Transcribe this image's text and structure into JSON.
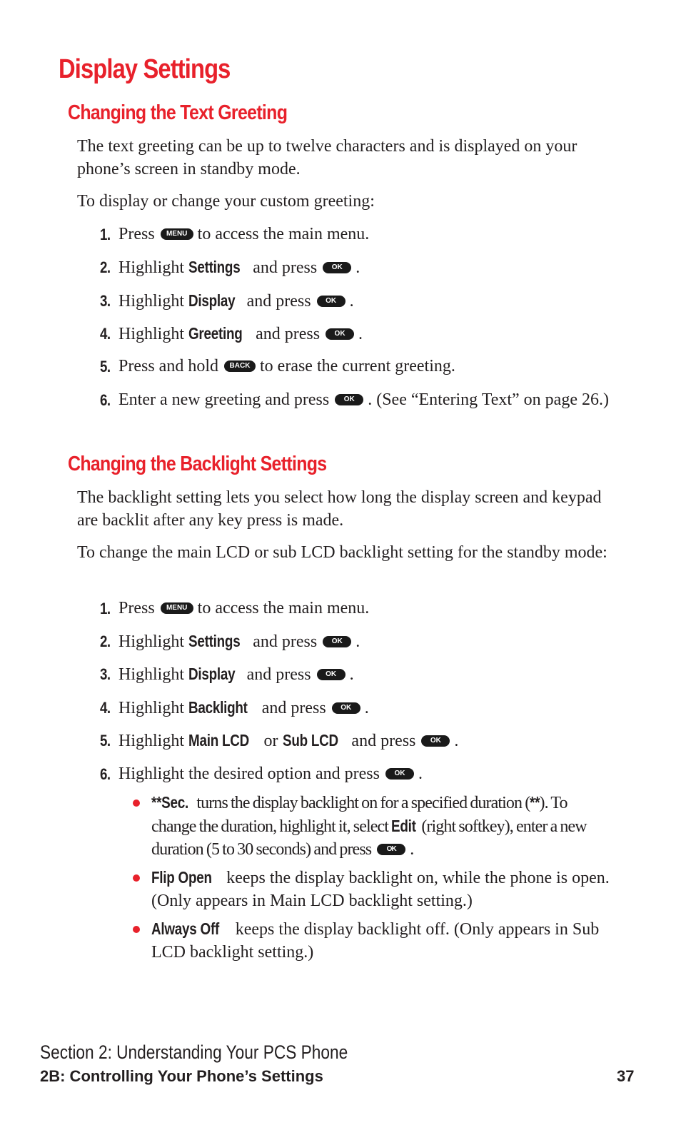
{
  "page_title": "Display Settings",
  "accent_color": "#e8212b",
  "sections": [
    {
      "title": "Changing the Text Greeting",
      "paragraphs": [
        "The text greeting can be up to twelve characters and is displayed on your phone’s screen in standby mode.",
        "To display or change your custom greeting:"
      ],
      "steps": [
        {
          "num": "1.",
          "pre": "Press",
          "key": "MENU",
          "post": "to access the main menu."
        },
        {
          "num": "2.",
          "pre": "Highlight",
          "kw": "Settings",
          "mid": "and press",
          "key": "OK",
          "post": "."
        },
        {
          "num": "3.",
          "pre": "Highlight",
          "kw": "Display",
          "mid": "and press",
          "key": "OK",
          "post": "."
        },
        {
          "num": "4.",
          "pre": "Highlight",
          "kw": "Greeting",
          "mid": "and press",
          "key": "OK",
          "post": "."
        },
        {
          "num": "5.",
          "pre": "Press and hold",
          "key": "BACK",
          "post": "to erase the current greeting."
        },
        {
          "num": "6.",
          "pre": "Enter a new greeting and press",
          "key": "OK",
          "post": ". (See “Entering Text” on page 26.)"
        }
      ]
    },
    {
      "title": "Changing the Backlight Settings",
      "paragraphs": [
        "The backlight setting lets you select how long the display screen and keypad are backlit after any key press is made.",
        "To change the main LCD or sub LCD backlight setting for the standby mode:"
      ],
      "steps": [
        {
          "num": "1.",
          "pre": "Press",
          "key": "MENU",
          "post": "to access the main menu."
        },
        {
          "num": "2.",
          "pre": "Highlight",
          "kw": "Settings",
          "mid": "and press",
          "key": "OK",
          "post": "."
        },
        {
          "num": "3.",
          "pre": "Highlight",
          "kw": "Display",
          "mid": "and press",
          "key": "OK",
          "post": "."
        },
        {
          "num": "4.",
          "pre": "Highlight",
          "kw": "Backlight",
          "mid": "and press",
          "key": "OK",
          "post": "."
        },
        {
          "num": "5.",
          "pre": "Highlight",
          "kw": "Main LCD",
          "mid": "or",
          "kw2": "Sub LCD",
          "mid2": "and press",
          "key": "OK",
          "post": "."
        },
        {
          "num": "6.",
          "pre": "Highlight the desired option and press",
          "key": "OK",
          "post": "."
        }
      ],
      "bullets": [
        {
          "kw": "**Sec.",
          "text": "turns the display backlight on for a specified duration (",
          "kw_b": "**",
          "text_b": "). To change the duration, highlight it, select",
          "kw_c": "Edit",
          "text_c": "(right softkey), enter a new duration (5 to 30 seconds) and press",
          "key": "OK",
          "post": "."
        },
        {
          "kw": "Flip Open",
          "text": "keeps the display backlight on, while the phone is open. (Only appears in Main LCD backlight setting.)"
        },
        {
          "kw": "Always Off",
          "text": "keeps the display backlight off. (Only appears in Sub LCD backlight setting.)"
        }
      ]
    }
  ],
  "footer": {
    "section": "Section 2: Understanding Your PCS Phone",
    "chapter": "2B: Controlling Your Phone’s Settings",
    "page_number": "37"
  }
}
